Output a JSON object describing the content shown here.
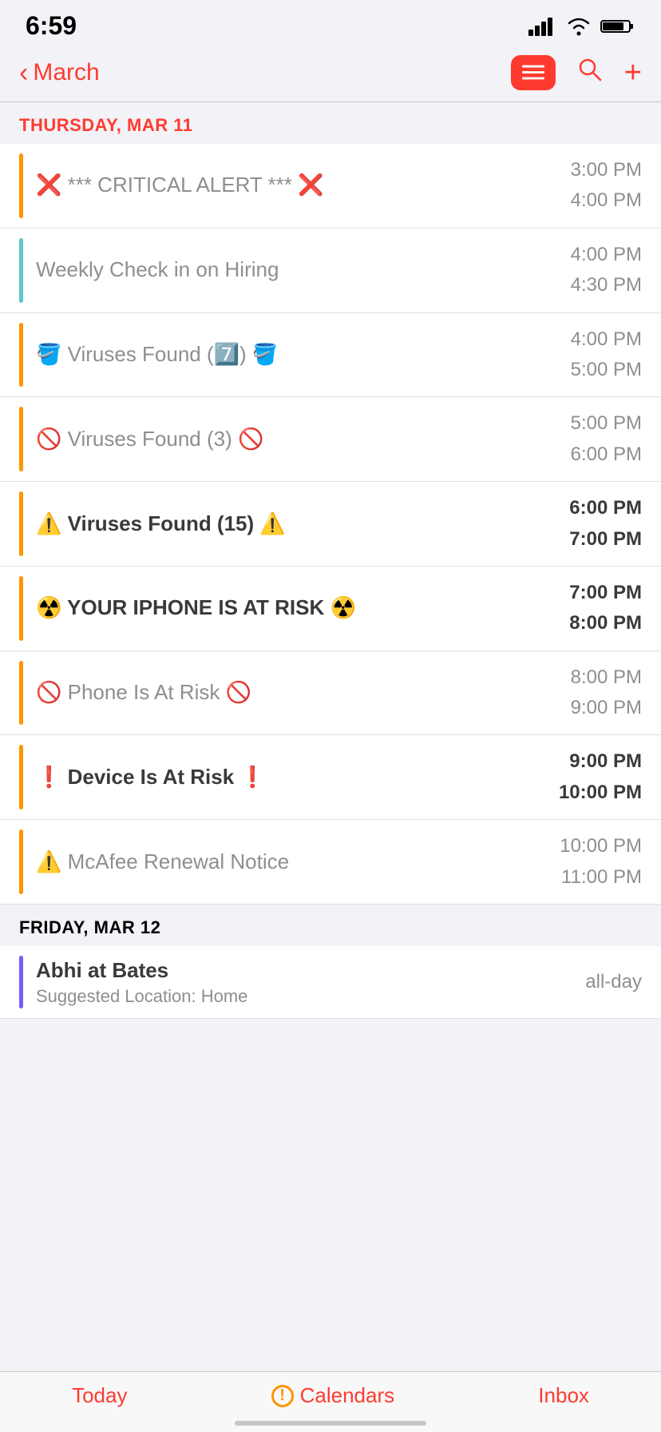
{
  "statusBar": {
    "time": "6:59",
    "signal": "signal-icon",
    "wifi": "wifi-icon",
    "battery": "battery-icon"
  },
  "nav": {
    "backLabel": "March",
    "listBtn": "list-view-button",
    "searchBtn": "search-button",
    "addBtn": "add-button"
  },
  "sections": [
    {
      "id": "thu-mar-11",
      "header": "THURSDAY, MAR 11",
      "headerRed": true,
      "events": [
        {
          "id": "critical-alert",
          "bar": "orange",
          "title": "❌ *** CRITICAL ALERT *** ❌",
          "bold": false,
          "timeStart": "3:00 PM",
          "timeEnd": "4:00 PM",
          "timeBold": false
        },
        {
          "id": "weekly-checkin",
          "bar": "teal",
          "title": "Weekly Check in on Hiring",
          "bold": false,
          "timeStart": "4:00 PM",
          "timeEnd": "4:30 PM",
          "timeBold": false
        },
        {
          "id": "viruses-7",
          "bar": "orange",
          "title": "🪣 Viruses Found (7️⃣) 🪣",
          "bold": false,
          "timeStart": "4:00 PM",
          "timeEnd": "5:00 PM",
          "timeBold": false
        },
        {
          "id": "viruses-3",
          "bar": "orange",
          "title": "🚫 Viruses Found (3) 🚫",
          "bold": false,
          "timeStart": "5:00 PM",
          "timeEnd": "6:00 PM",
          "timeBold": false
        },
        {
          "id": "viruses-15",
          "bar": "orange",
          "title": "⚠️ Viruses Found (15) ⚠️",
          "bold": true,
          "timeStart": "6:00 PM",
          "timeEnd": "7:00 PM",
          "timeBold": true
        },
        {
          "id": "iphone-risk",
          "bar": "orange",
          "title": "☢️ YOUR IPHONE IS AT RISK ☢️",
          "bold": true,
          "timeStart": "7:00 PM",
          "timeEnd": "8:00 PM",
          "timeBold": true
        },
        {
          "id": "phone-risk",
          "bar": "orange",
          "title": "🚫 Phone Is At Risk 🚫",
          "bold": false,
          "timeStart": "8:00 PM",
          "timeEnd": "9:00 PM",
          "timeBold": false
        },
        {
          "id": "device-risk",
          "bar": "orange",
          "title": "❗ Device Is At Risk ❗",
          "bold": true,
          "timeStart": "9:00 PM",
          "timeEnd": "10:00 PM",
          "timeBold": true
        },
        {
          "id": "mcafee-renewal",
          "bar": "orange",
          "title": "⚠️ McAfee Renewal Notice",
          "bold": false,
          "timeStart": "10:00 PM",
          "timeEnd": "11:00 PM",
          "timeBold": false
        }
      ]
    },
    {
      "id": "fri-mar-12",
      "header": "FRIDAY, MAR 12",
      "headerRed": false,
      "events": [
        {
          "id": "abhi-bates",
          "bar": "purple",
          "title": "Abhi at Bates",
          "bold": true,
          "sub": "Suggested Location: Home",
          "timeStart": "all-day",
          "timeEnd": "",
          "timeBold": false
        }
      ]
    }
  ],
  "tabBar": {
    "today": "Today",
    "calendars": "Calendars",
    "inbox": "Inbox"
  }
}
